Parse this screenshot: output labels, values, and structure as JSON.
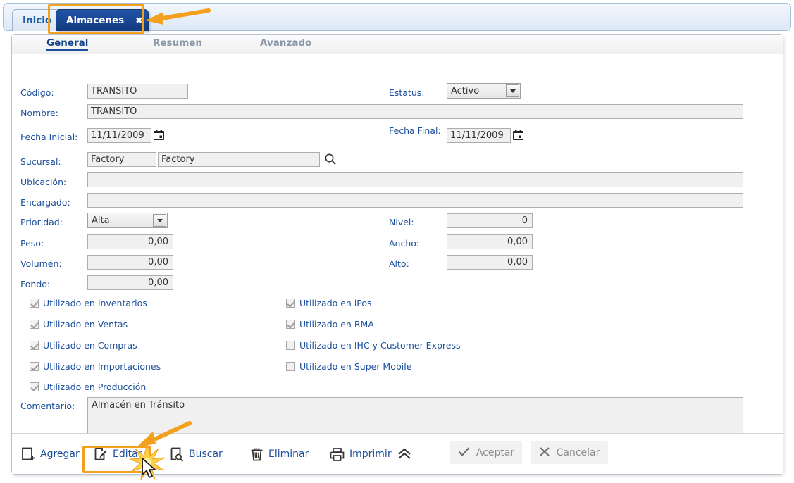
{
  "window": {
    "tabs": [
      {
        "label": "Inicio",
        "active": false
      },
      {
        "label": "Almacenes",
        "active": true,
        "close_icon": "close-icon"
      }
    ]
  },
  "inner_tabs": [
    {
      "label": "General",
      "active": true
    },
    {
      "label": "Resumen",
      "active": false
    },
    {
      "label": "Avanzado",
      "active": false
    }
  ],
  "form": {
    "codigo": {
      "label": "Código:",
      "value": "TRANSITO"
    },
    "estatus": {
      "label": "Estatus:",
      "value": "Activo"
    },
    "nombre": {
      "label": "Nombre:",
      "value": "TRANSITO"
    },
    "fecha_inicial": {
      "label": "Fecha Inicial:",
      "value": "11/11/2009"
    },
    "fecha_final": {
      "label": "Fecha Final:",
      "value": "11/11/2009"
    },
    "sucursal": {
      "label": "Sucursal:",
      "code": "Factory",
      "name": "Factory"
    },
    "ubicacion": {
      "label": "Ubicación:",
      "value": ""
    },
    "encargado": {
      "label": "Encargado:",
      "value": ""
    },
    "prioridad": {
      "label": "Prioridad:",
      "value": "Alta"
    },
    "nivel": {
      "label": "Nivel:",
      "value": "0"
    },
    "peso": {
      "label": "Peso:",
      "value": "0,00"
    },
    "ancho": {
      "label": "Ancho:",
      "value": "0,00"
    },
    "volumen": {
      "label": "Volumen:",
      "value": "0,00"
    },
    "alto": {
      "label": "Alto:",
      "value": "0,00"
    },
    "fondo": {
      "label": "Fondo:",
      "value": "0,00"
    },
    "comentario": {
      "label": "Comentario:",
      "value": "Almacén en Tránsito"
    }
  },
  "checkboxes_left": [
    {
      "label": "Utilizado en Inventarios",
      "checked": true
    },
    {
      "label": "Utilizado en Ventas",
      "checked": true
    },
    {
      "label": "Utilizado en Compras",
      "checked": true
    },
    {
      "label": "Utilizado en Importaciones",
      "checked": true
    },
    {
      "label": "Utilizado en Producción",
      "checked": true
    }
  ],
  "checkboxes_right": [
    {
      "label": "Utilizado en iPos",
      "checked": true
    },
    {
      "label": "Utilizado en RMA",
      "checked": true
    },
    {
      "label": "Utilizado en IHC y Customer Express",
      "checked": false
    },
    {
      "label": "Utilizado en Super Mobile",
      "checked": false
    }
  ],
  "toolbar": {
    "agregar": {
      "label": "Agregar",
      "icon": "add-document-icon"
    },
    "editar": {
      "label": "Editar",
      "icon": "edit-pencil-icon",
      "highlighted": true
    },
    "buscar": {
      "label": "Buscar",
      "icon": "search-document-icon"
    },
    "eliminar": {
      "label": "Eliminar",
      "icon": "trash-icon"
    },
    "imprimir": {
      "label": "Imprimir",
      "icon": "printer-icon"
    },
    "collapse": {
      "icon": "double-chevron-up-icon"
    },
    "aceptar": {
      "label": "Aceptar",
      "icon": "check-icon",
      "disabled": true
    },
    "cancelar": {
      "label": "Cancelar",
      "icon": "x-icon",
      "disabled": true
    }
  },
  "colors": {
    "label_blue": "#1c4f9c",
    "active_tab_blue": "#12397e",
    "annotation_orange": "#f2a01e",
    "field_bg": "#f0f0f0",
    "disabled_gray": "#8c8c8c"
  }
}
